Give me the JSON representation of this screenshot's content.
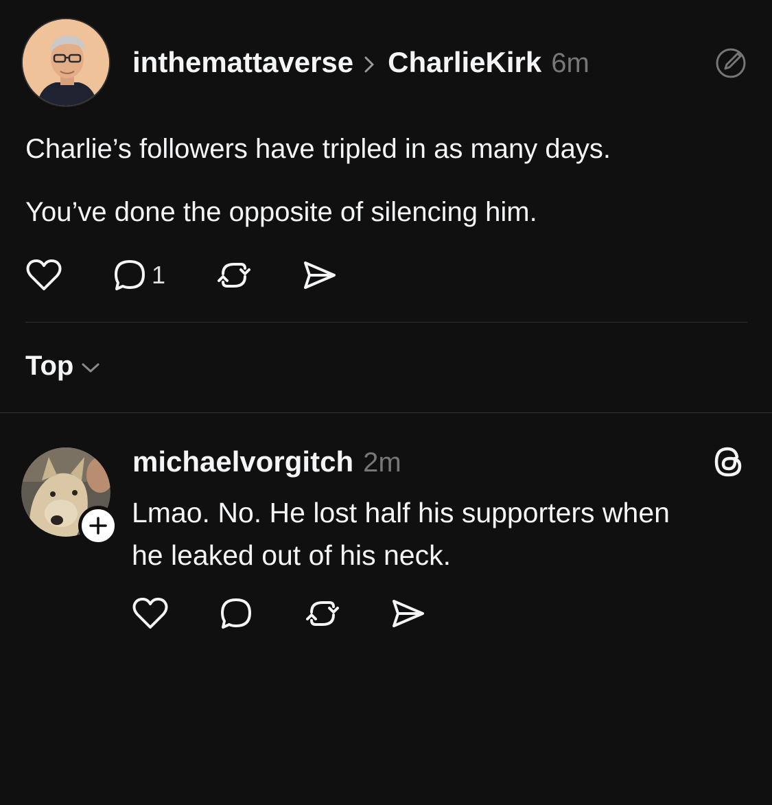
{
  "main_post": {
    "username": "inthemattaverse",
    "target_username": "CharlieKirk",
    "time": "6m",
    "paragraphs": [
      "Charlie’s followers have tripled in as many days.",
      "You’ve done the opposite of silencing him."
    ],
    "reply_count": "1",
    "icons": [
      "avatar",
      "chevron-right-icon",
      "edit-icon",
      "heart-icon",
      "comment-icon",
      "repost-icon",
      "share-icon"
    ]
  },
  "sort": {
    "label": "Top",
    "icon": "chevron-down-icon"
  },
  "reply": {
    "username": "michaelvorgitch",
    "time": "2m",
    "text_lines": [
      "Lmao. No. He lost half his supporters when",
      "he leaked out of his neck."
    ],
    "icons": [
      "avatar",
      "follow-plus-icon",
      "threads-icon",
      "heart-icon",
      "comment-icon",
      "repost-icon",
      "share-icon"
    ]
  },
  "colors": {
    "background": "#101010",
    "text": "#f3f5f7",
    "muted": "#777777",
    "divider": "#323232"
  }
}
